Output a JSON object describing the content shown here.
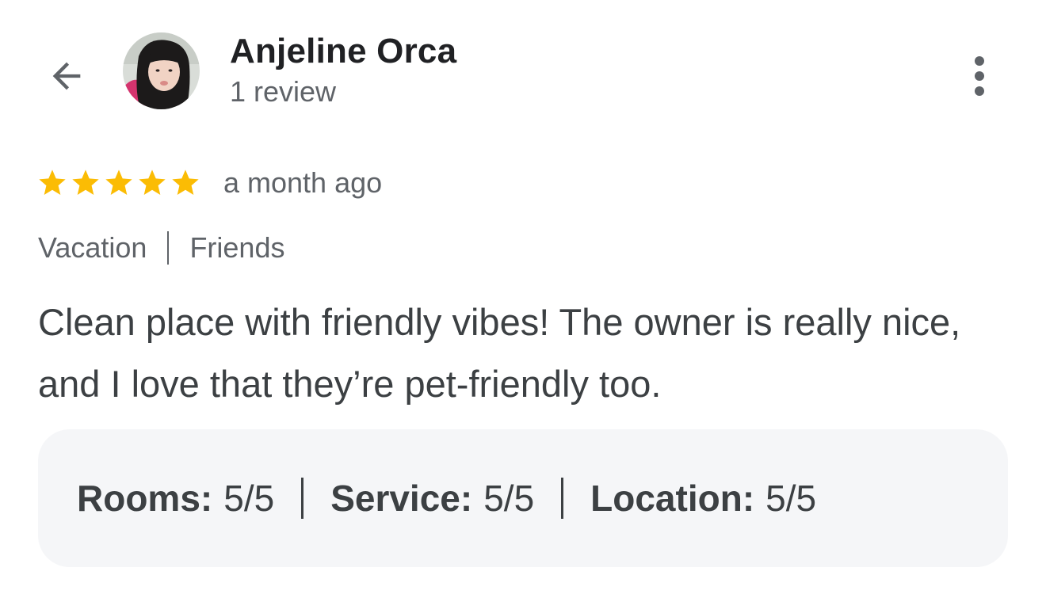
{
  "header": {
    "back_icon": "arrow-back-icon",
    "user_name": "Anjeline Orca",
    "review_count": "1 review",
    "more_icon": "more-vertical-icon"
  },
  "review": {
    "stars": 5,
    "max_stars": 5,
    "star_color": "#fbbc04",
    "time_ago": "a month ago",
    "tags": [
      "Vacation",
      "Friends"
    ],
    "text": "Clean place with friendly vibes! The owner is really nice, and I love that they’re pet-friendly too."
  },
  "sub_ratings": [
    {
      "label": "Rooms:",
      "value": "5/5"
    },
    {
      "label": "Service:",
      "value": "5/5"
    },
    {
      "label": "Location:",
      "value": "5/5"
    }
  ],
  "colors": {
    "primary_text": "#202124",
    "secondary_text": "#5f6368",
    "body_text": "#3c4043",
    "card_bg": "#f5f6f8"
  }
}
